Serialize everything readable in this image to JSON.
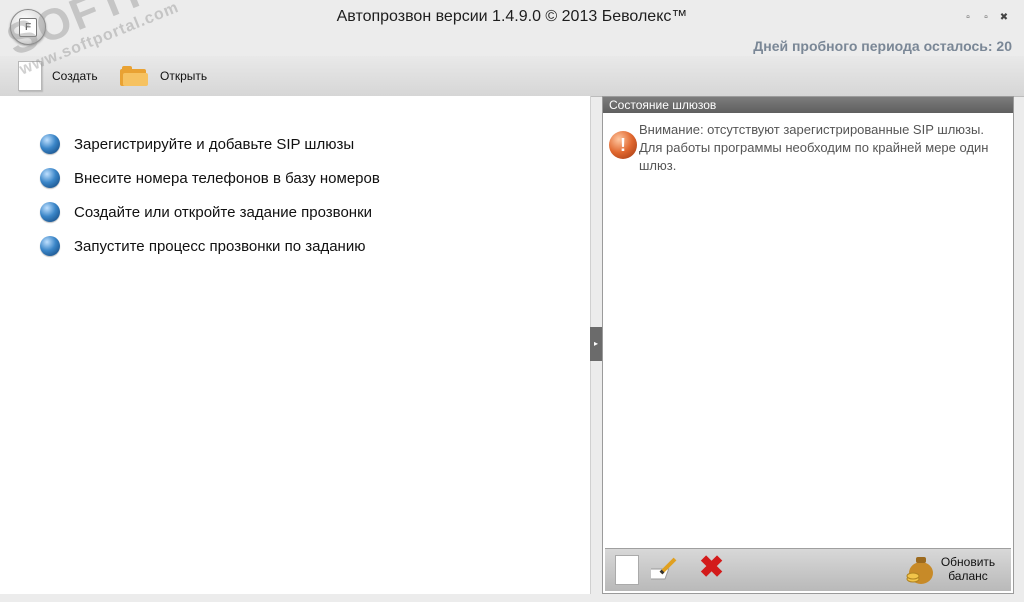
{
  "window": {
    "title": "Автопрозвон версии 1.4.9.0 © 2013 Беволекс™",
    "app_button_letter": "F",
    "controls": {
      "minimize": "▫",
      "maximize": "▫",
      "close": "✖"
    }
  },
  "trial": {
    "text": "Дней пробного периода осталось: 20"
  },
  "toolbar": {
    "create_label": "Создать",
    "open_label": "Открыть"
  },
  "steps": [
    "Зарегистрируйте и добавьте SIP шлюзы",
    "Внесите номера телефонов в базу номеров",
    "Создайте или откройте задание прозвонки",
    "Запустите процесс прозвонки по заданию"
  ],
  "gateway_panel": {
    "title": "Состояние шлюзов",
    "warning_text": "Внимание: отсутствуют зарегистрированные SIP шлюзы. Для работы программы необходим по крайней мере один шлюз.",
    "warning_icon": "!",
    "delete_icon": "✖",
    "balance_line1": "Обновить",
    "balance_line2": "баланс"
  },
  "splitter": {
    "arrow": "▸"
  },
  "watermark": {
    "main": "SOFTPORTAL",
    "sub": "www.softportal.com"
  },
  "icons": {
    "app": "app-menu-icon",
    "create": "new-document-icon",
    "open": "open-folder-icon",
    "step": "blue-sphere-bullet-icon",
    "warning": "warning-exclamation-icon",
    "edit": "edit-pencil-icon",
    "delete": "delete-x-icon",
    "money": "money-bag-icon"
  },
  "colors": {
    "trial_text": "#7a8796",
    "accent_blue": "#3b86c8",
    "warning_orange": "#e0672e",
    "delete_red": "#d31a1a"
  }
}
